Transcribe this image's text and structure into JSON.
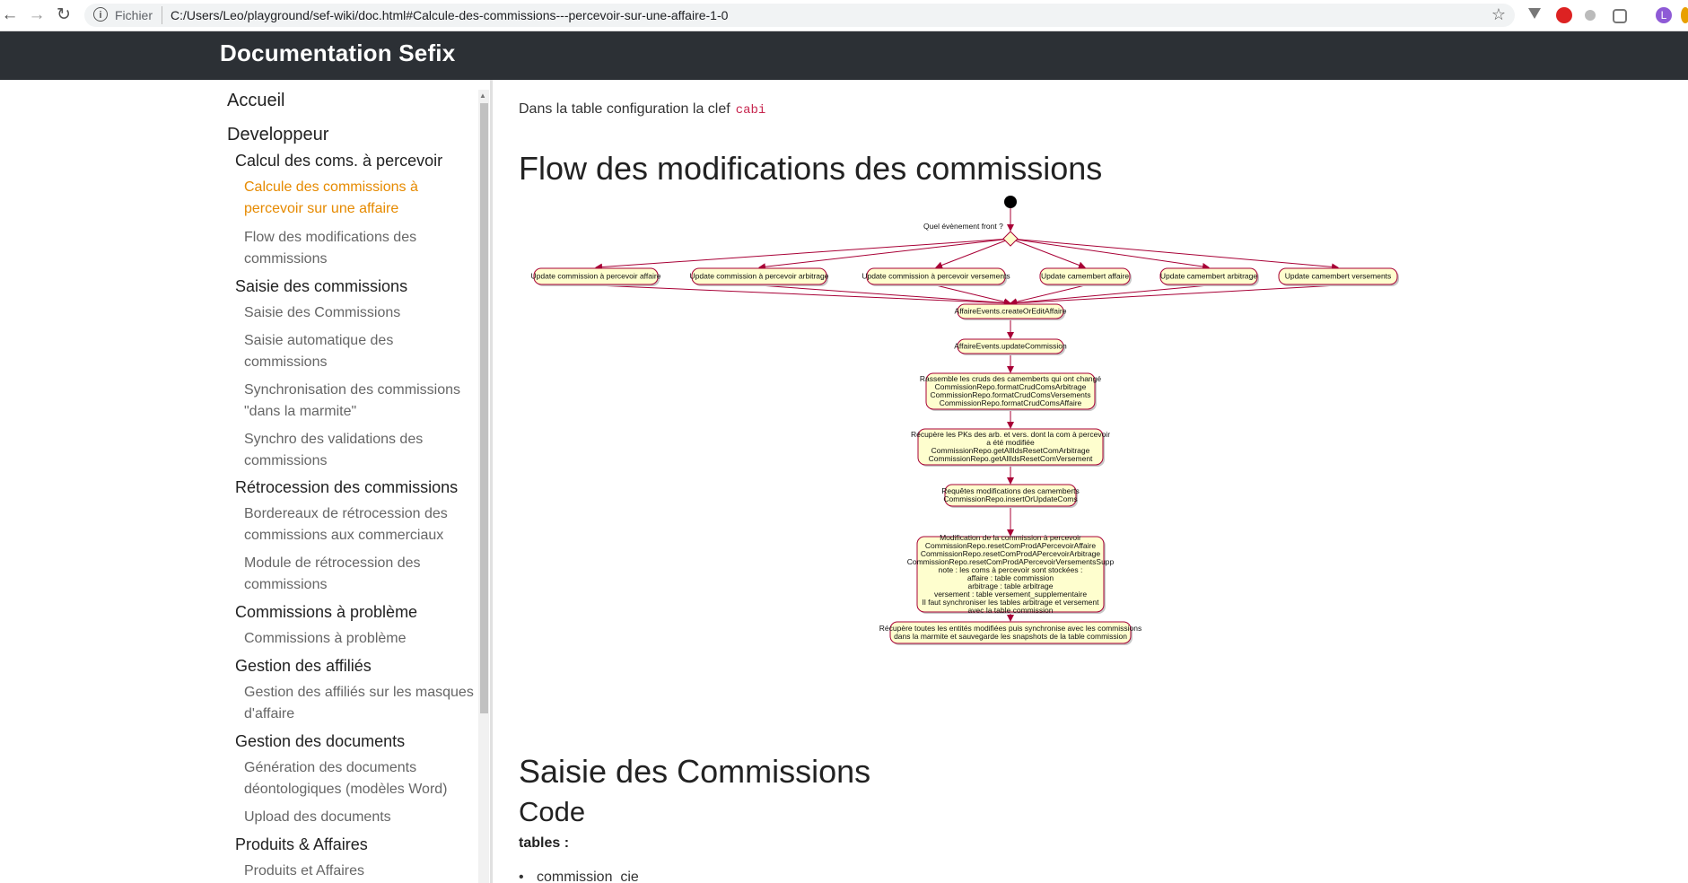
{
  "browser": {
    "scheme": "Fichier",
    "url": "C:/Users/Leo/playground/sef-wiki/doc.html#Calcule-des-commissions---percevoir-sur-une-affaire-1-0",
    "icons": [
      "back-icon",
      "forward-icon",
      "reload-icon",
      "info-icon",
      "star-icon",
      "extension-icons",
      "profile-avatar"
    ]
  },
  "site": {
    "title": "Documentation Sefix"
  },
  "sidebar": {
    "top_items": [
      {
        "label": "Accueil"
      },
      {
        "label": "Developpeur"
      }
    ],
    "sections": [
      {
        "label": "Calcul des coms. à percevoir",
        "items": [
          "Calcule des commissions à percevoir sur une affaire",
          "Flow des modifications des commissions"
        ]
      },
      {
        "label": "Saisie des commissions",
        "items": [
          "Saisie des Commissions",
          "Saisie automatique des commissions",
          "Synchronisation des commissions \"dans la marmite\"",
          "Synchro des validations des commissions"
        ]
      },
      {
        "label": "Rétrocession des commissions",
        "items": [
          "Bordereaux de rétrocession des commissions aux commerciaux",
          "Module de rétrocession des commissions"
        ]
      },
      {
        "label": "Commissions à problème",
        "items": [
          "Commissions à problème"
        ]
      },
      {
        "label": "Gestion des affiliés",
        "items": [
          "Gestion des affiliés sur les masques d'affaire"
        ]
      },
      {
        "label": "Gestion des documents",
        "items": [
          "Génération des documents déontologiques (modèles Word)",
          "Upload des documents"
        ]
      },
      {
        "label": "Produits & Affaires",
        "items": [
          "Produits et Affaires"
        ]
      }
    ],
    "active_item": "Calcule des commissions à percevoir sur une affaire"
  },
  "content": {
    "cut_line": "...",
    "para_text": "Dans la table configuration la clef",
    "para_code": "cabi",
    "h1_flow": "Flow des modifications des commissions",
    "h1_saisie": "Saisie des Commissions",
    "h2_code": "Code",
    "tables_label": "tables :",
    "list_item": "commission_cie"
  },
  "diagram": {
    "decision_label": "Quel évènement front ?",
    "events": [
      "Update commission à percevoir affaire",
      "Update commission à percevoir arbitrage",
      "Update commission à percevoir versements",
      "Update camembert affaire",
      "Update camembert arbitrage",
      "Update camembert versements"
    ],
    "steps": [
      [
        "AffaireEvents.createOrEditAffaire"
      ],
      [
        "AffaireEvents.updateCommission"
      ],
      [
        "Rassemble les cruds des camemberts qui ont changé",
        "CommissionRepo.formatCrudComsArbitrage",
        "CommissionRepo.formatCrudComsVersements",
        "CommissionRepo.formatCrudComsAffaire"
      ],
      [
        "Récupère les PKs des arb. et vers. dont la com à percevoir",
        "a été modifiée",
        "CommissionRepo.getAllIdsResetComArbitrage",
        "CommissionRepo.getAllIdsResetComVersement"
      ],
      [
        "Requêtes modifications des camemberts",
        "CommissionRepo.insertOrUpdateComs"
      ],
      [
        "Modification de la commission à percevoir",
        "CommissionRepo.resetComProdAPercevoirAffaire",
        "CommissionRepo.resetComProdAPercevoirArbitrage",
        "CommissionRepo.resetComProdAPercevoirVersementsSupp",
        "note : les coms à percevoir sont stockées :",
        "affaire : table commission",
        "arbitrage : table arbitrage",
        "versement : table versement_supplementaire",
        "Il faut synchroniser les tables arbitrage et versement",
        "avec la table commission"
      ],
      [
        "Récupère toutes les entités modifiées puis synchronise avec les commissions",
        "dans la marmite et sauvegarde les snapshots de la table commission"
      ]
    ],
    "colors": {
      "node_fill": "#fefece",
      "node_stroke": "#a80036",
      "edge": "#a80036"
    }
  }
}
